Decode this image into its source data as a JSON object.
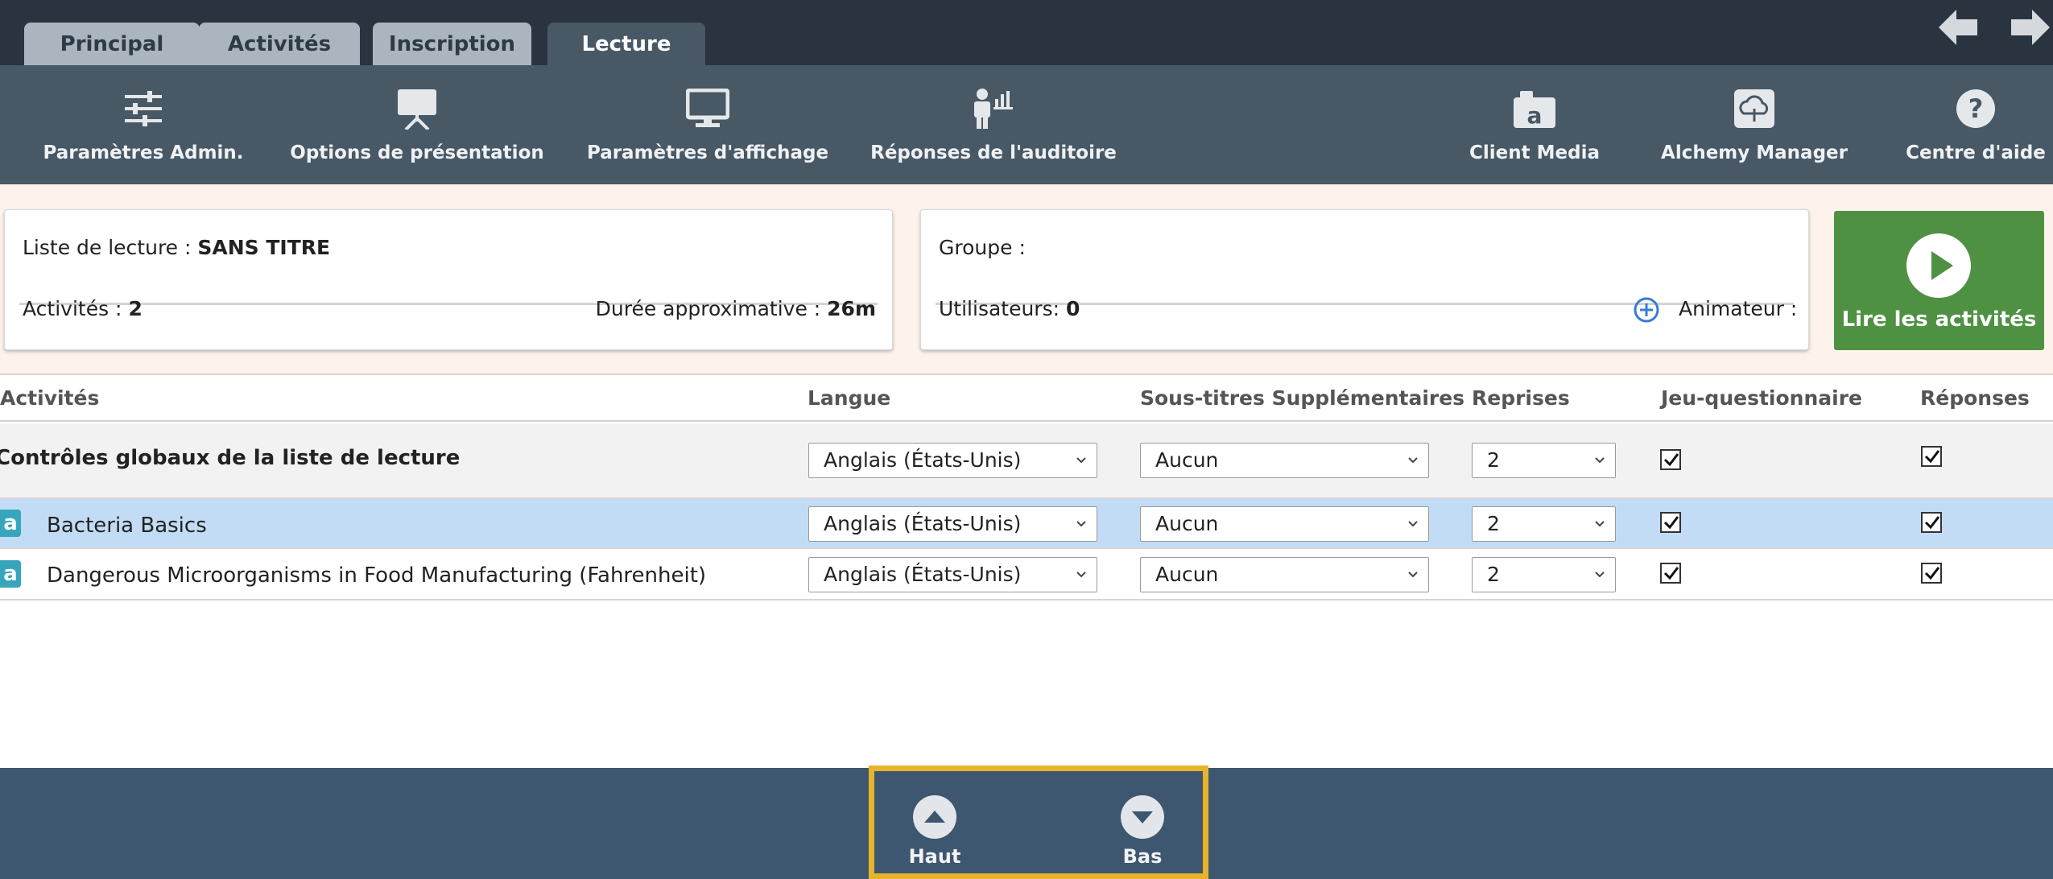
{
  "tabs": [
    {
      "label": "Principal"
    },
    {
      "label": "Activités"
    },
    {
      "label": "Inscription"
    },
    {
      "label": "Lecture",
      "active": true
    }
  ],
  "toolbar": {
    "admin_settings": "Paramètres Admin.",
    "presentation_options": "Options de présentation",
    "display_settings": "Paramètres d'affichage",
    "audience_responses": "Réponses de l'auditoire",
    "client_media": "Client Media",
    "alchemy_manager": "Alchemy Manager",
    "help_center": "Centre d'aide"
  },
  "playlist": {
    "title_label": "Liste de lecture :",
    "title_value": "SANS TITRE",
    "activities_label": "Activités :",
    "activities_value": "2",
    "duration_label": "Durée approximative :",
    "duration_value": "26m"
  },
  "group": {
    "group_label": "Groupe :",
    "users_label": "Utilisateurs:",
    "users_value": "0",
    "facilitator_label": "Animateur :"
  },
  "play_button": {
    "label": "Lire les activités"
  },
  "table": {
    "headers": {
      "activities": "Activités",
      "language": "Langue",
      "subtitles": "Sous-titres Supplémentaires",
      "replays": "Reprises",
      "quiz": "Jeu-questionnaire",
      "answers": "Réponses"
    },
    "global_row": {
      "title": "Contrôles globaux de la liste de lecture",
      "language": "Anglais (États-Unis)",
      "subtitles": "Aucun",
      "replays": "2",
      "quiz_checked": true,
      "answers_checked": true
    },
    "rows": [
      {
        "badge": "a",
        "name": "Bacteria Basics",
        "language": "Anglais (États-Unis)",
        "subtitles": "Aucun",
        "replays": "2",
        "quiz_checked": true,
        "answers_checked": true,
        "selected": true
      },
      {
        "badge": "a",
        "name": "Dangerous Microorganisms in Food Manufacturing (Fahrenheit)",
        "language": "Anglais (États-Unis)",
        "subtitles": "Aucun",
        "replays": "2",
        "quiz_checked": true,
        "answers_checked": true,
        "selected": false
      }
    ]
  },
  "bottom_nav": {
    "up_label": "Haut",
    "down_label": "Bas"
  },
  "colors": {
    "tabbar_bg": "#2a3340",
    "toolbar_bg": "#485865",
    "play_green": "#4f9142",
    "selected_row": "#c3dcf6",
    "bottom_bar": "#3e5770",
    "highlight": "#e9b32b"
  }
}
